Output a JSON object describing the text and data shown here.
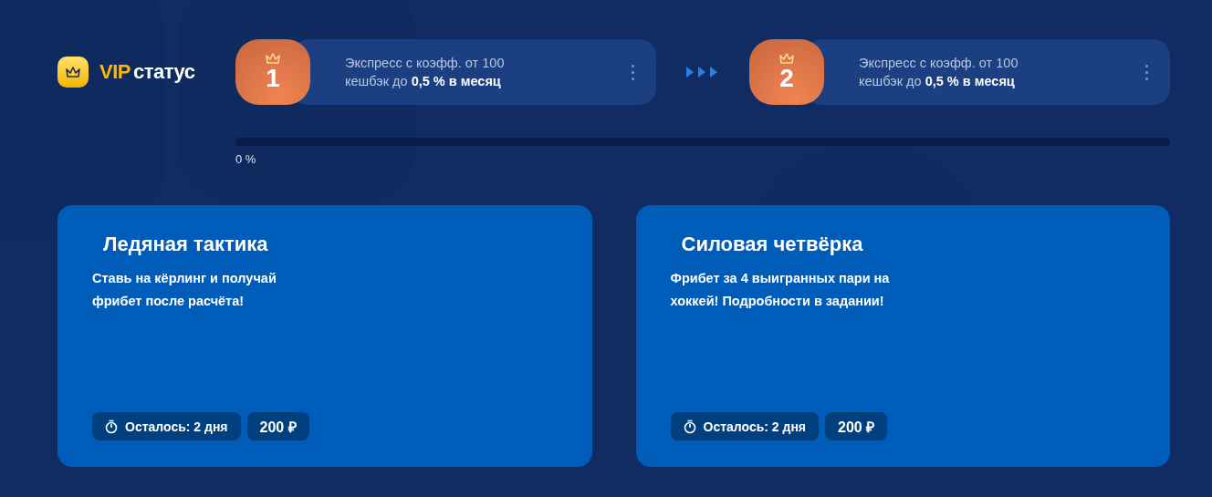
{
  "vip": {
    "accent": "VIP",
    "label": "статус"
  },
  "levels": [
    {
      "number": "1",
      "line1": "Экспресс с коэфф. от 100",
      "line2": "кешбэк до **0,5 % в месяц**"
    },
    {
      "number": "2",
      "line1": "Экспресс с коэфф. от 100",
      "line2": "кешбэк до **0,5 % в месяц**"
    }
  ],
  "progress": {
    "level": 0,
    "reading": "0 %"
  },
  "promos": [
    {
      "title": "Ледяная тактика",
      "text": "Ставь на кёрлинг и получай фрибет после расчёта!",
      "timer": "Осталось: 2 дня",
      "amount": "200 ₽"
    },
    {
      "title": "Силовая четвёрка",
      "text": "Фрибет за 4 выигранных пари на хоккей! Подробности в задании!",
      "timer": "Осталось: 2 дня",
      "amount": "200 ₽"
    }
  ]
}
